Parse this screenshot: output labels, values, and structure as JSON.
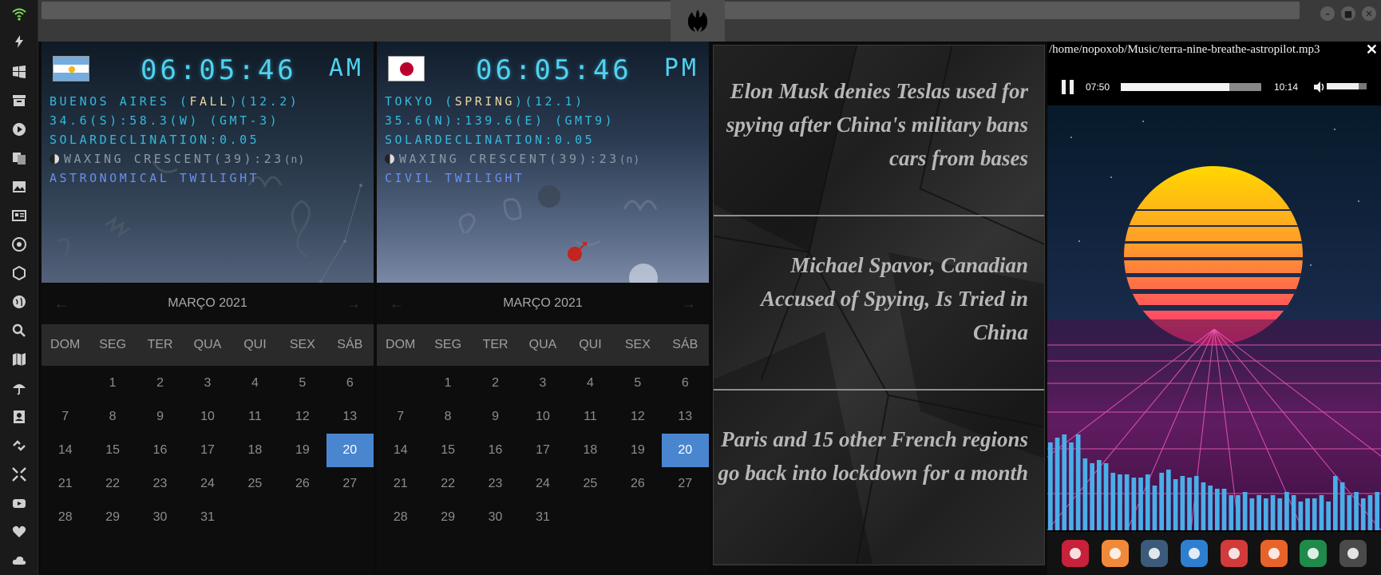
{
  "sidebar": {
    "items": [
      {
        "icon": "wifi-icon"
      },
      {
        "icon": "lightning-icon"
      },
      {
        "icon": "windows-icon"
      },
      {
        "icon": "archive-icon"
      },
      {
        "icon": "play-icon"
      },
      {
        "icon": "translate-icon"
      },
      {
        "icon": "image-icon"
      },
      {
        "icon": "news-icon"
      },
      {
        "icon": "rebel-alliance-icon"
      },
      {
        "icon": "hexagon-icon"
      },
      {
        "icon": "globe-icon"
      },
      {
        "icon": "search-icon"
      },
      {
        "icon": "map-icon"
      },
      {
        "icon": "umbrella-icon"
      },
      {
        "icon": "contacts-icon"
      },
      {
        "icon": "link-icon"
      },
      {
        "icon": "fullscreen-icon"
      },
      {
        "icon": "youtube-icon"
      },
      {
        "icon": "heart-icon"
      },
      {
        "icon": "cloud-icon"
      }
    ]
  },
  "clocks": [
    {
      "flag": "argentina",
      "time": "06:05:46",
      "ampm": "AM",
      "city": "BUENOS AIRES",
      "season": "FALL",
      "season_suffix": "(12.2)",
      "coords": "34.6(S):58.3(W) (GMT-3)",
      "solar": "SOLARDECLINATION:0.05",
      "moon": "WAXING CRESCENT(39):23",
      "moon_hemisphere": "(n)",
      "twilight": "ASTRONOMICAL TWILIGHT"
    },
    {
      "flag": "japan",
      "time": "06:05:46",
      "ampm": "PM",
      "city": "TOKYO",
      "season": "SPRING",
      "season_suffix": "(12.1)",
      "coords": "35.6(N):139.6(E) (GMT9)",
      "solar": "SOLARDECLINATION:0.05",
      "moon": "WAXING CRESCENT(39):23",
      "moon_hemisphere": "(n)",
      "twilight": "CIVIL TWILIGHT"
    }
  ],
  "calendar": {
    "month": "MARÇO 2021",
    "weekdays": [
      "DOM",
      "SEG",
      "TER",
      "QUA",
      "QUI",
      "SEX",
      "SÁB"
    ],
    "first_weekday": 1,
    "days": 31,
    "today": 20
  },
  "news": {
    "items": [
      "Elon Musk denies Teslas used for spying after China's military bans cars from bases",
      "Michael Spavor, Canadian Accused of Spying, Is Tried in China",
      "Paris and 15 other French regions go back into lockdown for a month"
    ]
  },
  "player": {
    "path": "/home/nopoxob/Music/terra-nine-breathe-astropilot.mp3",
    "close": "✕",
    "current_time": "07:50",
    "total_time": "10:14",
    "progress": 0.77,
    "volume": 0.8,
    "visualizer": [
      0.55,
      0.58,
      0.6,
      0.55,
      0.6,
      0.45,
      0.42,
      0.44,
      0.42,
      0.36,
      0.35,
      0.35,
      0.33,
      0.33,
      0.35,
      0.28,
      0.36,
      0.38,
      0.32,
      0.34,
      0.33,
      0.34,
      0.3,
      0.28,
      0.26,
      0.26,
      0.22,
      0.22,
      0.24,
      0.2,
      0.22,
      0.2,
      0.22,
      0.2,
      0.24,
      0.22,
      0.18,
      0.2,
      0.2,
      0.22,
      0.18,
      0.34,
      0.3,
      0.22,
      0.24,
      0.2,
      0.22,
      0.24
    ]
  },
  "dock": {
    "items": [
      {
        "icon": "arch-icon",
        "color": "#c7213b"
      },
      {
        "icon": "magnifier-icon",
        "color": "#f08a3a"
      },
      {
        "icon": "clock-icon",
        "color": "#3c5b7a"
      },
      {
        "icon": "globe-icon",
        "color": "#2f7fd0"
      },
      {
        "icon": "calendar-icon",
        "color": "#d23b3b"
      },
      {
        "icon": "play-arrow-icon",
        "color": "#e8632a"
      },
      {
        "icon": "yandex-icon",
        "color": "#1f8a4a"
      },
      {
        "icon": "calculator-icon",
        "color": "#4a4a4a"
      }
    ]
  },
  "colors": {
    "accent": "#4a86d0",
    "clock_text": "#4fd3f0",
    "twilight_text": "#6a8ff0"
  }
}
